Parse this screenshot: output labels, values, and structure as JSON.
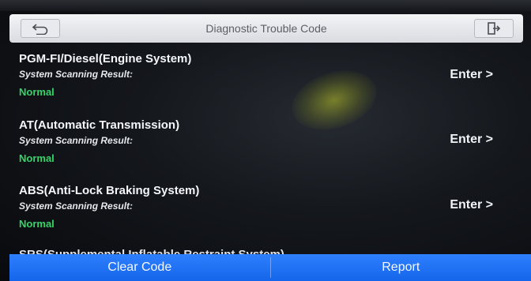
{
  "header": {
    "title": "Diagnostic Trouble Code",
    "back_icon": "back-arrow-icon",
    "exit_icon": "exit-icon"
  },
  "systems": [
    {
      "name": "PGM-FI/Diesel(Engine System)",
      "scan_label": "System Scanning Result:",
      "status": "Normal",
      "enter_label": "Enter >"
    },
    {
      "name": "AT(Automatic Transmission)",
      "scan_label": "System Scanning Result:",
      "status": "Normal",
      "enter_label": "Enter >"
    },
    {
      "name": "ABS(Anti-Lock Braking System)",
      "scan_label": "System Scanning Result:",
      "status": "Normal",
      "enter_label": "Enter >"
    }
  ],
  "partial_system": "SRS(Supplemental Inflatable Restraint System)",
  "bottom_bar": {
    "clear_code_label": "Clear Code",
    "report_label": "Report"
  },
  "colors": {
    "status_normal": "#37d36a",
    "bottom_bar": "#1e6ff5",
    "header_bg": "#e6e8ec"
  }
}
